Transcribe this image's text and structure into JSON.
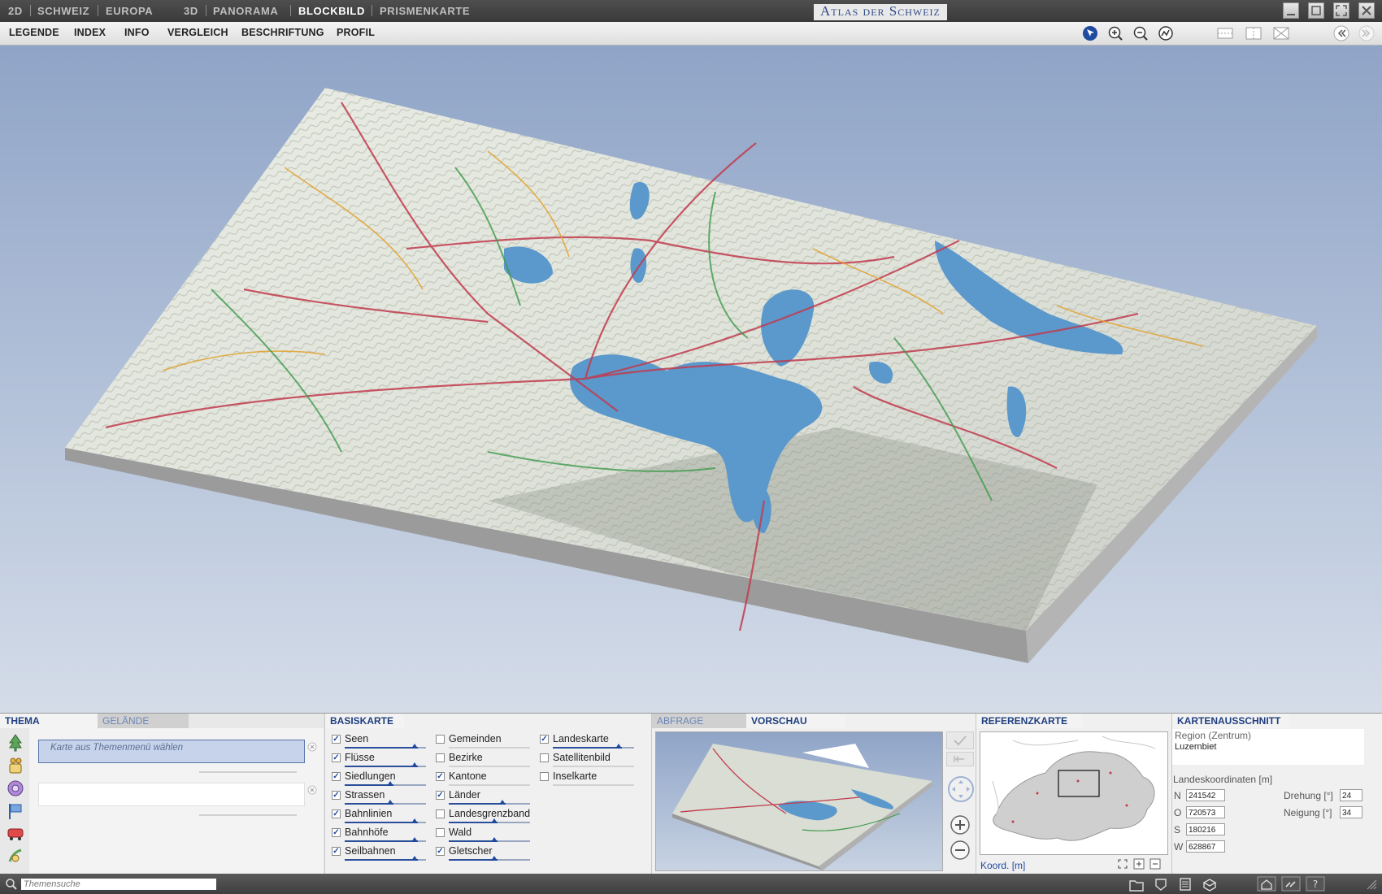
{
  "titlebar": {
    "app_title": "Atlas der Schweiz",
    "modes_2d": [
      "2D",
      "SCHWEIZ",
      "EUROPA"
    ],
    "modes_3d": [
      "3D",
      "PANORAMA",
      "BLOCKBILD",
      "PRISMENKARTE"
    ],
    "active_mode": "BLOCKBILD"
  },
  "menubar": {
    "items": [
      "LEGENDE",
      "INDEX",
      "INFO",
      "VERGLEICH",
      "BESCHRIFTUNG",
      "PROFIL"
    ],
    "tool_icons": [
      "pointer-icon",
      "zoom-in-icon",
      "zoom-out-icon",
      "rotate-icon",
      "split-horizontal-icon",
      "split-vertical-icon",
      "close-view-icon",
      "collapse-left-icon",
      "expand-right-icon"
    ]
  },
  "thema_panel": {
    "tabs": [
      "THEMA",
      "GELÄNDE"
    ],
    "active_tab": "THEMA",
    "placeholder": "Karte aus Themenmenü wählen",
    "side_icons": [
      "forest-icon",
      "population-icon",
      "economy-icon",
      "flag-icon",
      "transport-icon",
      "communication-icon"
    ]
  },
  "basiskarte": {
    "title": "BASISKARTE",
    "col1": [
      {
        "label": "Seen",
        "checked": true,
        "slider": 0.9
      },
      {
        "label": "Flüsse",
        "checked": true,
        "slider": 0.9
      },
      {
        "label": "Siedlungen",
        "checked": true,
        "slider": 0.6
      },
      {
        "label": "Strassen",
        "checked": true,
        "slider": 0.6
      },
      {
        "label": "Bahnlinien",
        "checked": true,
        "slider": 0.9
      },
      {
        "label": "Bahnhöfe",
        "checked": true,
        "slider": 0.9
      },
      {
        "label": "Seilbahnen",
        "checked": true,
        "slider": 0.9
      }
    ],
    "col2": [
      {
        "label": "Gemeinden",
        "checked": false,
        "slider": 0.0
      },
      {
        "label": "Bezirke",
        "checked": false,
        "slider": 0.0
      },
      {
        "label": "Kantone",
        "checked": true,
        "slider": 0.0
      },
      {
        "label": "Länder",
        "checked": true,
        "slider": 0.7
      },
      {
        "label": "Landesgrenzband",
        "checked": false,
        "slider": 0.6
      },
      {
        "label": "Wald",
        "checked": false,
        "slider": 0.6
      },
      {
        "label": "Gletscher",
        "checked": true,
        "slider": 0.6
      }
    ],
    "col3": [
      {
        "label": "Landeskarte",
        "checked": true,
        "slider": 0.85
      },
      {
        "label": "Satellitenbild",
        "checked": false,
        "slider": 0.0
      },
      {
        "label": "Inselkarte",
        "checked": false,
        "slider": 0.0
      }
    ]
  },
  "vorschau": {
    "tabs": [
      "ABFRAGE",
      "VORSCHAU"
    ],
    "active_tab": "VORSCHAU"
  },
  "referenzkarte": {
    "title": "REFERENZKARTE",
    "footer": "Koord. [m]"
  },
  "kartenausschnitt": {
    "title": "KARTENAUSSCHNITT",
    "region_label": "Region (Zentrum)",
    "region_value": "Luzernbiet",
    "coords_label": "Landeskoordinaten [m]",
    "n_label": "N",
    "n_value": "241542",
    "o_label": "O",
    "o_value": "720573",
    "s_label": "S",
    "s_value": "180216",
    "w_label": "W",
    "w_value": "628867",
    "drehung_label": "Drehung [°]",
    "drehung_value": "24",
    "neigung_label": "Neigung [°]",
    "neigung_value": "34"
  },
  "statusbar": {
    "search_placeholder": "Themensuche",
    "icons": [
      "folder-icon",
      "bookmark-icon",
      "print-icon",
      "export-icon",
      "home-icon",
      "link-icon",
      "help-icon"
    ]
  }
}
